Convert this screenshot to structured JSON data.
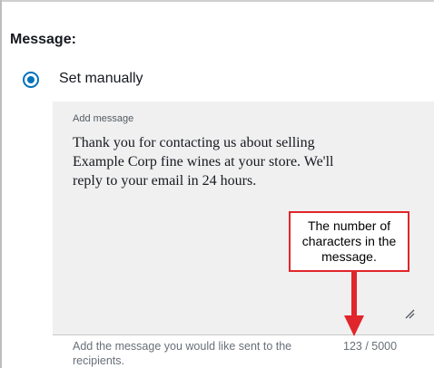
{
  "section": {
    "heading": "Message:"
  },
  "option": {
    "label": "Set manually",
    "selected": true
  },
  "message_field": {
    "label": "Add message",
    "value": "Thank you for contacting us about selling\nExample Corp fine wines at your store. We'll\nreply to your email in 24 hours.",
    "helper": "Add the message you would like sent to the recipients.",
    "char_count": "123 / 5000"
  },
  "annotation": {
    "text": "The number of characters in the message.",
    "color": "#e0262a"
  },
  "colors": {
    "radio_accent": "#0073bb",
    "textarea_background": "#f0f0f0"
  },
  "icons": {
    "resize": "resize-handle-icon",
    "arrow": "arrow-down-icon"
  }
}
